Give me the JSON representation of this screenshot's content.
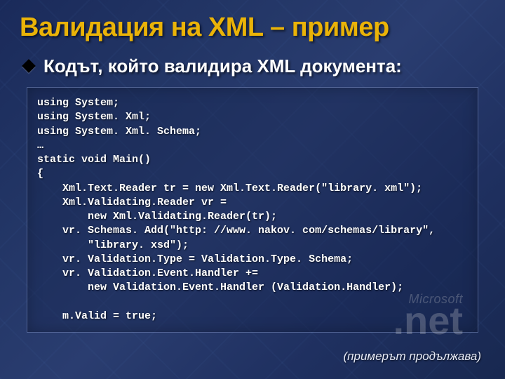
{
  "slide": {
    "title": "Валидация на XML – пример",
    "subtitle": "Кодът, който валидира XML документа:",
    "code": "using System;\nusing System. Xml;\nusing System. Xml. Schema;\n…\nstatic void Main()\n{\n    Xml.Text.Reader tr = new Xml.Text.Reader(\"library. xml\");\n    Xml.Validating.Reader vr =\n        new Xml.Validating.Reader(tr);\n    vr. Schemas. Add(\"http: //www. nakov. com/schemas/library\",\n        \"library. xsd\");\n    vr. Validation.Type = Validation.Type. Schema;\n    vr. Validation.Event.Handler +=\n        new Validation.Event.Handler (Validation.Handler);\n\n    m.Valid = true;",
    "footnote": "(примерът продължава)",
    "logo": {
      "brand": "Microsoft",
      "product": ".net"
    }
  }
}
